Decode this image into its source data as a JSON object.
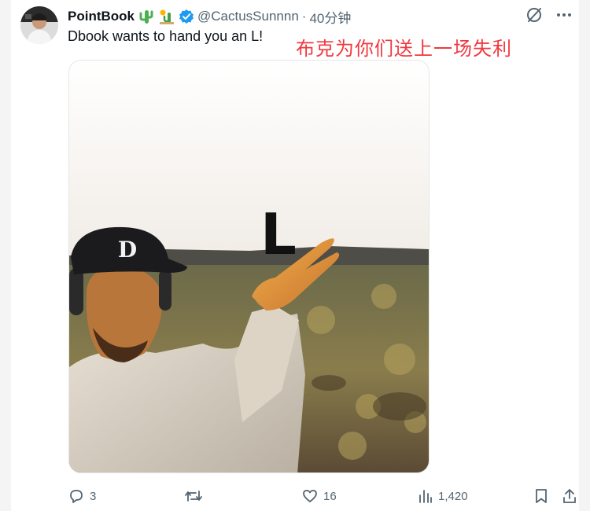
{
  "author": {
    "name": "PointBook",
    "handle": "@CactusSunnnn",
    "separator": "·",
    "time": "40分钟",
    "badge_emojis": [
      "cactus-emoji",
      "sunny-cactus-emoji"
    ],
    "verified_color": "#1d9bf0"
  },
  "tweet": {
    "text": "Dbook wants to hand you an L!",
    "overlay_caption": "布克为你们送上一场失利",
    "overlay_caption_color": "#f0393f",
    "media": {
      "description_icon": "meme-photo",
      "hat_logo": "D",
      "letter": "L"
    }
  },
  "actions": {
    "replies": "3",
    "reposts": "",
    "likes": "16",
    "views": "1,420"
  },
  "colors": {
    "text": "#0f1419",
    "muted": "#536471",
    "accent": "#1d9bf0"
  }
}
